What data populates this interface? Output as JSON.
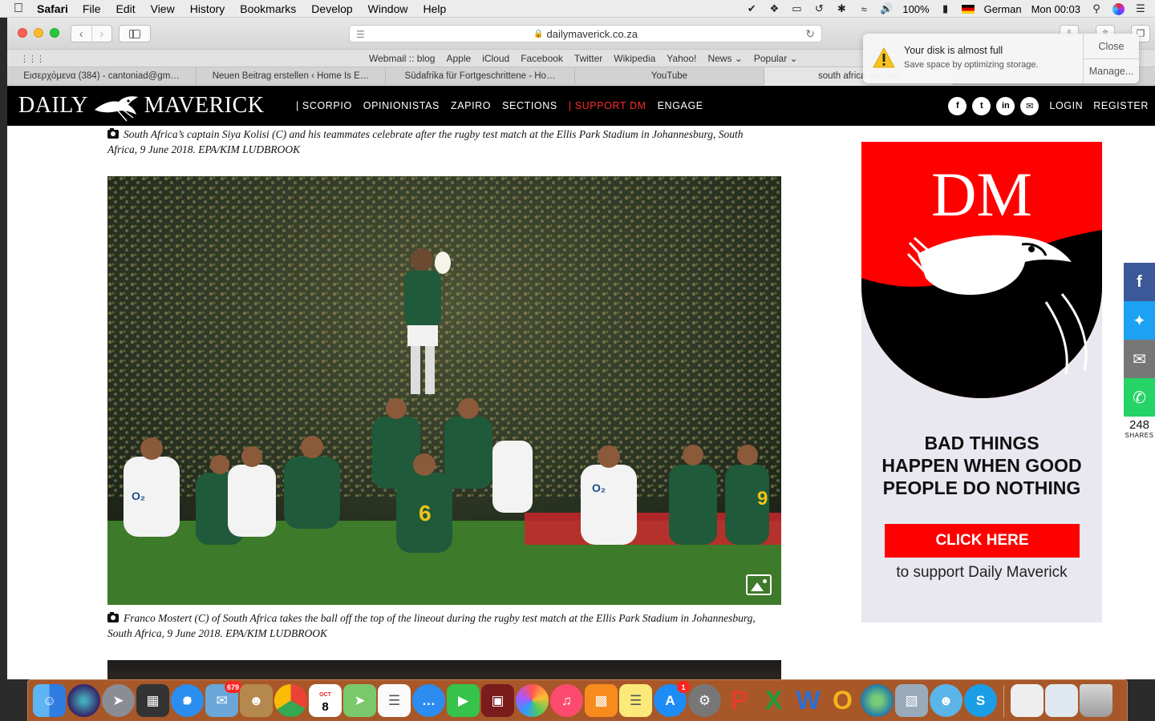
{
  "menubar": {
    "app_name": "Safari",
    "items": [
      "File",
      "Edit",
      "View",
      "History",
      "Bookmarks",
      "Develop",
      "Window",
      "Help"
    ],
    "battery": "100%",
    "input_source": "German",
    "clock": "Mon 00:03"
  },
  "browser": {
    "url": "dailymaverick.co.za",
    "favorites": [
      "Webmail :: blog",
      "Apple",
      "iCloud",
      "Facebook",
      "Twitter",
      "Wikipedia",
      "Yahoo!",
      "News ⌄",
      "Popular ⌄"
    ],
    "tabs": [
      "Εισερχόμενα (384) - cantoniad@gm…",
      "Neuen Beitrag erstellen ‹ Home Is E…",
      "Südafrika für Fortgeschrittene - Ho…",
      "YouTube",
      "south africa ellis sta"
    ]
  },
  "notification": {
    "title": "Your disk is almost full",
    "message": "Save space by optimizing storage.",
    "close_label": "Close",
    "manage_label": "Manage..."
  },
  "site": {
    "logo_left": "DAILY",
    "logo_right": "MAVERICK",
    "nav": [
      "| SCORPIO",
      "OPINIONISTAS",
      "ZAPIRO",
      "SECTIONS",
      "| SUPPORT DM",
      "ENGAGE"
    ],
    "login": "LOGIN",
    "register": "REGISTER",
    "social_icons": [
      "facebook-icon",
      "twitter-icon",
      "linkedin-icon",
      "email-icon"
    ]
  },
  "article": {
    "caption_1": "South Africa’s captain Siya Kolisi (C) and his teammates celebrate after the rugby test match at the Ellis Park Stadium in Johannesburg, South Africa, 9 June 2018. EPA/KIM LUDBROOK",
    "caption_2": "Franco Mostert (C) of South Africa takes the ball off the top of the lineout during the rugby test match at the Ellis Park Stadium in Johannesburg, South Africa, 9 June 2018. EPA/KIM LUDBROOK"
  },
  "ad": {
    "logo_text": "DM",
    "slogan_1": "BAD THINGS",
    "slogan_2": "HAPPEN WHEN GOOD",
    "slogan_3": "PEOPLE DO NOTHING",
    "cta": "CLICK HERE",
    "sub": "to support Daily Maverick"
  },
  "share": {
    "count": "248",
    "label": "SHARES",
    "colors": {
      "facebook": "#3b5998",
      "twitter": "#1da1f2",
      "email": "#777777",
      "whatsapp": "#25d366"
    }
  },
  "dock": {
    "mail_badge": "679",
    "calendar_month": "OCT",
    "calendar_day": "8",
    "appstore_badge": "1"
  },
  "colors": {
    "brand_red": "#ff0000",
    "header_bg": "#000000",
    "ad_bg": "#e9e8f0"
  }
}
